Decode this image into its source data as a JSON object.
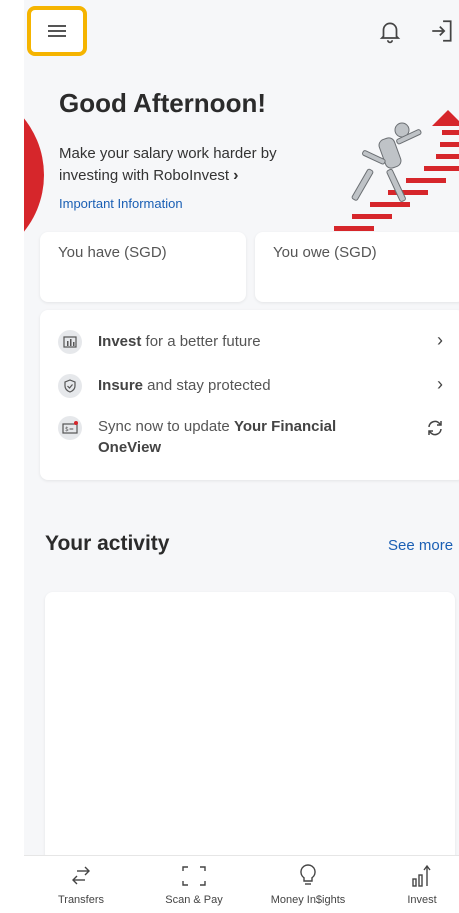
{
  "header": {
    "menu_icon": "hamburger-menu-icon",
    "notification_icon": "bell-icon",
    "logout_icon": "logout-icon"
  },
  "hero": {
    "greeting": "Good Afternoon!",
    "tagline": "Make your salary work harder by investing with RoboInvest",
    "tagline_chevron": "›",
    "important_link": "Important Information",
    "illustration": "robot-running-up-stairs"
  },
  "balances": {
    "have_label": "You have (SGD)",
    "owe_label": "You owe (SGD)"
  },
  "actions": {
    "invest": {
      "bold": "Invest",
      "rest": " for a better future"
    },
    "insure": {
      "bold": "Insure",
      "rest": " and stay protected"
    },
    "sync": {
      "pre": "Sync now to update ",
      "bold": "Your Financial OneView"
    }
  },
  "activity": {
    "title": "Your activity",
    "see_more": "See more"
  },
  "bottom_nav": {
    "items": [
      {
        "label": "Transfers",
        "icon": "transfer-arrows-icon"
      },
      {
        "label": "Scan & Pay",
        "icon": "scan-icon"
      },
      {
        "label": "Money In$ights",
        "icon": "lightbulb-icon"
      },
      {
        "label": "Invest",
        "icon": "invest-chart-icon"
      }
    ]
  },
  "colors": {
    "accent_blue": "#1a5fb4",
    "brand_red": "#d6262b",
    "highlight_yellow": "#f5b400"
  }
}
